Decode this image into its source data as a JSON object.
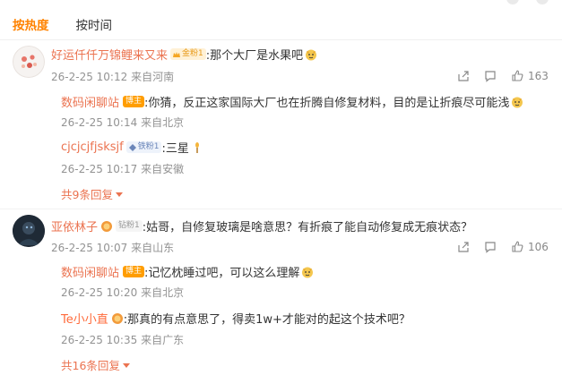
{
  "tabs": [
    "按热度",
    "按时间"
  ],
  "colors": {
    "accent": "#ff8200",
    "username": "#eb7350",
    "meta": "#939393"
  },
  "comments": [
    {
      "user": "好运仟仟万锦鲤来又来",
      "badge": "金粉1",
      "text": ":那个大厂是水果吧",
      "emoji": "doge-emoji",
      "time": "26-2-25 10:12",
      "location": "来自河南",
      "likes": "163",
      "replies": [
        {
          "user": "数码闲聊站",
          "badge": "博主",
          "text": ":你猜，反正这家国际大厂也在折腾自修复材料，目的是让折痕尽可能浅",
          "emoji": "doge-emoji",
          "time": "26-2-25 10:14",
          "location": "来自北京"
        },
        {
          "user": "cjcjcjfjsksjf",
          "badge": "铁粉1",
          "text": ":三星",
          "emoji": "candle-emoji",
          "time": "26-2-25 10:17",
          "location": "来自安徽"
        }
      ],
      "more": "共9条回复"
    },
    {
      "user": "亚依林子",
      "badge": "钻粉1",
      "text": ":姑哥，自修复玻璃是啥意思？有折痕了能自动修复成无痕状态？",
      "time": "26-2-25 10:07",
      "location": "来自山东",
      "likes": "106",
      "replies": [
        {
          "user": "数码闲聊站",
          "badge": "博主",
          "text": ":记忆枕睡过吧，可以这么理解",
          "emoji": "doge-emoji",
          "time": "26-2-25 10:20",
          "location": "来自北京"
        },
        {
          "user": "Te小小直",
          "text": ":那真的有点意思了，得卖1w+才能对的起这个技术吧？",
          "time": "26-2-25 10:35",
          "location": "来自广东"
        }
      ],
      "more": "共16条回复"
    }
  ]
}
